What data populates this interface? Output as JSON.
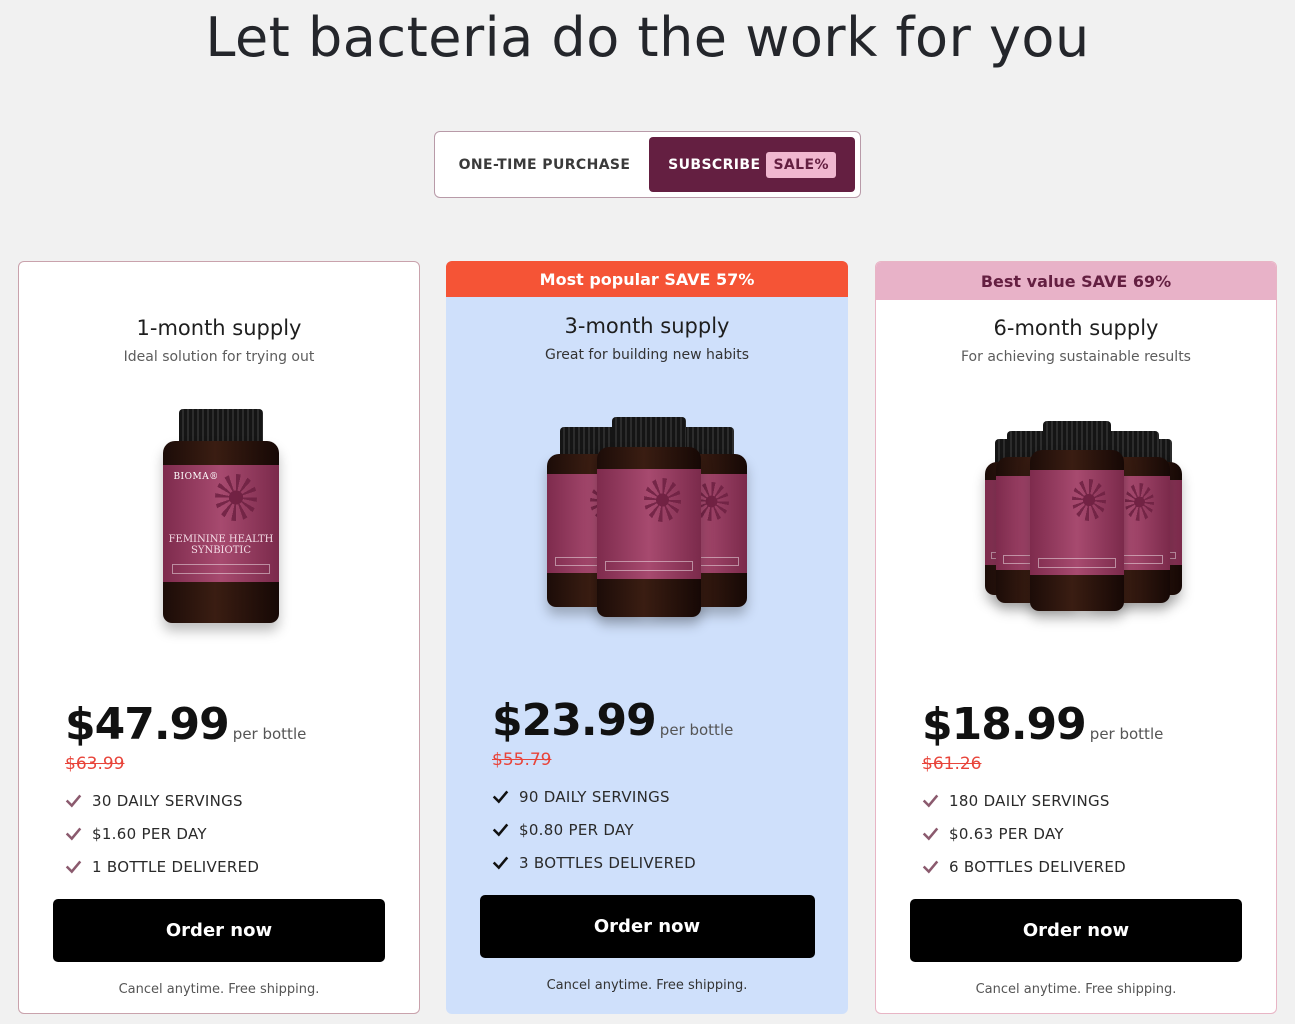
{
  "headline": "Let bacteria do the work for you",
  "toggle": {
    "one_time_label": "ONE-TIME PURCHASE",
    "subscribe_label": "SUBSCRIBE",
    "sale_badge": "SALE%"
  },
  "colors": {
    "brand_plum": "#641f41",
    "popular_red": "#f55436",
    "best_value_pink": "#e8b2c8",
    "popular_bg": "#cfe0fb"
  },
  "plans": [
    {
      "ribbon": "",
      "title": "1-month supply",
      "subtitle": "Ideal solution for trying out",
      "price": "$47.99",
      "per": "per bottle",
      "old_price": "$63.99",
      "features": [
        "30 DAILY SERVINGS",
        "$1.60 PER DAY",
        "1 BOTTLE DELIVERED"
      ],
      "button": "Order now",
      "note": "Cancel anytime. Free shipping.",
      "bottle_label": {
        "brand": "BIOMA®",
        "line1": "FEMININE HEALTH",
        "line2": "SYNBIOTIC"
      }
    },
    {
      "ribbon": "Most popular SAVE 57%",
      "title": "3-month supply",
      "subtitle": "Great for building new habits",
      "price": "$23.99",
      "per": "per bottle",
      "old_price": "$55.79",
      "features": [
        "90 DAILY SERVINGS",
        "$0.80 PER DAY",
        "3 BOTTLES DELIVERED"
      ],
      "button": "Order now",
      "note": "Cancel anytime. Free shipping."
    },
    {
      "ribbon": "Best value SAVE 69%",
      "title": "6-month supply",
      "subtitle": "For achieving sustainable results",
      "price": "$18.99",
      "per": "per bottle",
      "old_price": "$61.26",
      "features": [
        "180 DAILY SERVINGS",
        "$0.63 PER DAY",
        "6 BOTTLES DELIVERED"
      ],
      "button": "Order now",
      "note": "Cancel anytime. Free shipping."
    }
  ],
  "icons": {
    "feature_check": "check-icon",
    "product": "supplement-bottle-image"
  }
}
